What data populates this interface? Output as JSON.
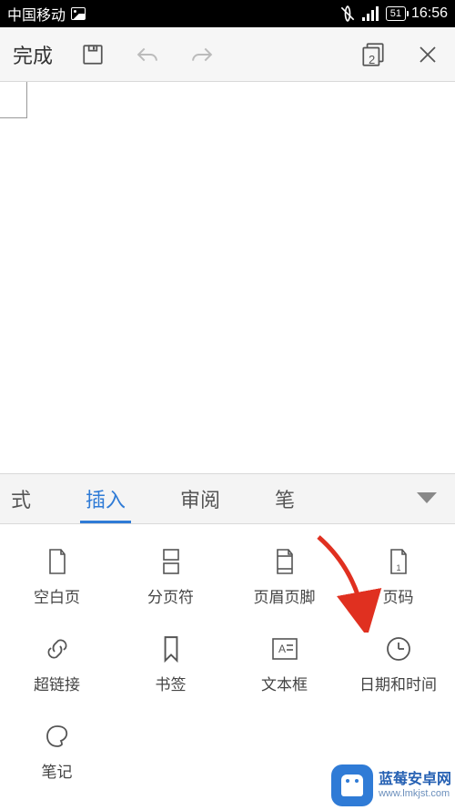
{
  "status": {
    "carrier": "中国移动",
    "battery": "51",
    "time": "16:56"
  },
  "toolbar": {
    "done": "完成",
    "page_count": "2"
  },
  "tabs": {
    "style_partial": "式",
    "insert": "插入",
    "review": "审阅",
    "pen": "笔"
  },
  "insert_grid": {
    "blank_page": "空白页",
    "page_break": "分页符",
    "header_footer": "页眉页脚",
    "page_number": "页码",
    "hyperlink": "超链接",
    "bookmark": "书签",
    "text_box": "文本框",
    "date_time": "日期和时间",
    "note": "笔记"
  },
  "watermark": {
    "title": "蓝莓安卓网",
    "url": "www.lmkjst.com"
  }
}
